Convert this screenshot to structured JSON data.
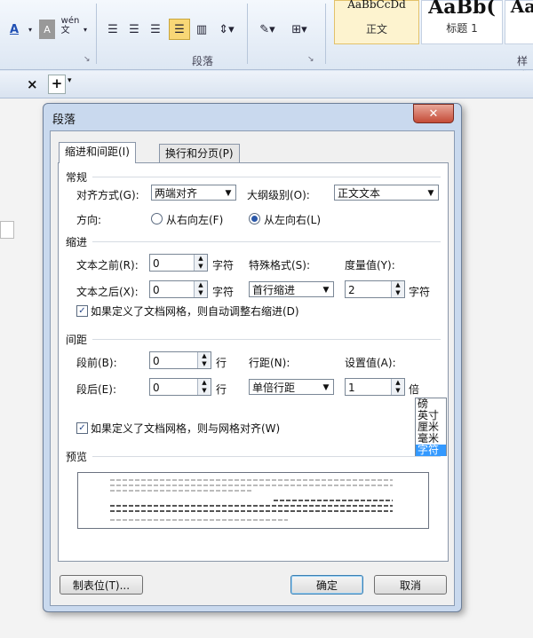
{
  "ribbon": {
    "font_color_glyph": "A",
    "font_style_glyph": "A",
    "phonetic_glyph": "wén\n文",
    "paragraph_group_label": "段落",
    "styles_group_label": "样式",
    "styles": [
      {
        "sample": "AaBbCcDd",
        "name": "正文"
      },
      {
        "sample": "AaBb(",
        "name": "标题 1"
      },
      {
        "sample": "Aa",
        "name": ""
      }
    ]
  },
  "tabbar": {
    "close": "×",
    "add": "+",
    "dropdown": "▾"
  },
  "dialog": {
    "title": "段落",
    "close": "✕",
    "tabs": [
      "缩进和间距(I)",
      "换行和分页(P)"
    ],
    "general": {
      "section": "常规",
      "alignment_label": "对齐方式(G):",
      "alignment_value": "两端对齐",
      "outline_label": "大纲级别(O):",
      "outline_value": "正文文本",
      "direction_label": "方向:",
      "rtl_label": "从右向左(F)",
      "ltr_label": "从左向右(L)"
    },
    "indent": {
      "section": "缩进",
      "before_label": "文本之前(R):",
      "before_value": "0",
      "before_unit": "字符",
      "after_label": "文本之后(X):",
      "after_value": "0",
      "after_unit": "字符",
      "special_label": "特殊格式(S):",
      "special_value": "首行缩进",
      "measure_label": "度量值(Y):",
      "measure_value": "2",
      "measure_unit": "字符",
      "unit_options": [
        "磅",
        "英寸",
        "厘米",
        "毫米",
        "字符"
      ],
      "grid_checkbox": "如果定义了文档网格，则自动调整右缩进(D)"
    },
    "spacing": {
      "section": "间距",
      "before_label": "段前(B):",
      "before_value": "0",
      "before_unit": "行",
      "after_label": "段后(E):",
      "after_value": "0",
      "after_unit": "行",
      "line_label": "行距(N):",
      "line_value": "单倍行距",
      "setting_label": "设置值(A):",
      "setting_value": "1",
      "setting_unit": "倍",
      "grid_checkbox": "如果定义了文档网格，则与网格对齐(W)"
    },
    "preview_section": "预览",
    "buttons": {
      "tabs": "制表位(T)...",
      "ok": "确定",
      "cancel": "取消"
    }
  }
}
